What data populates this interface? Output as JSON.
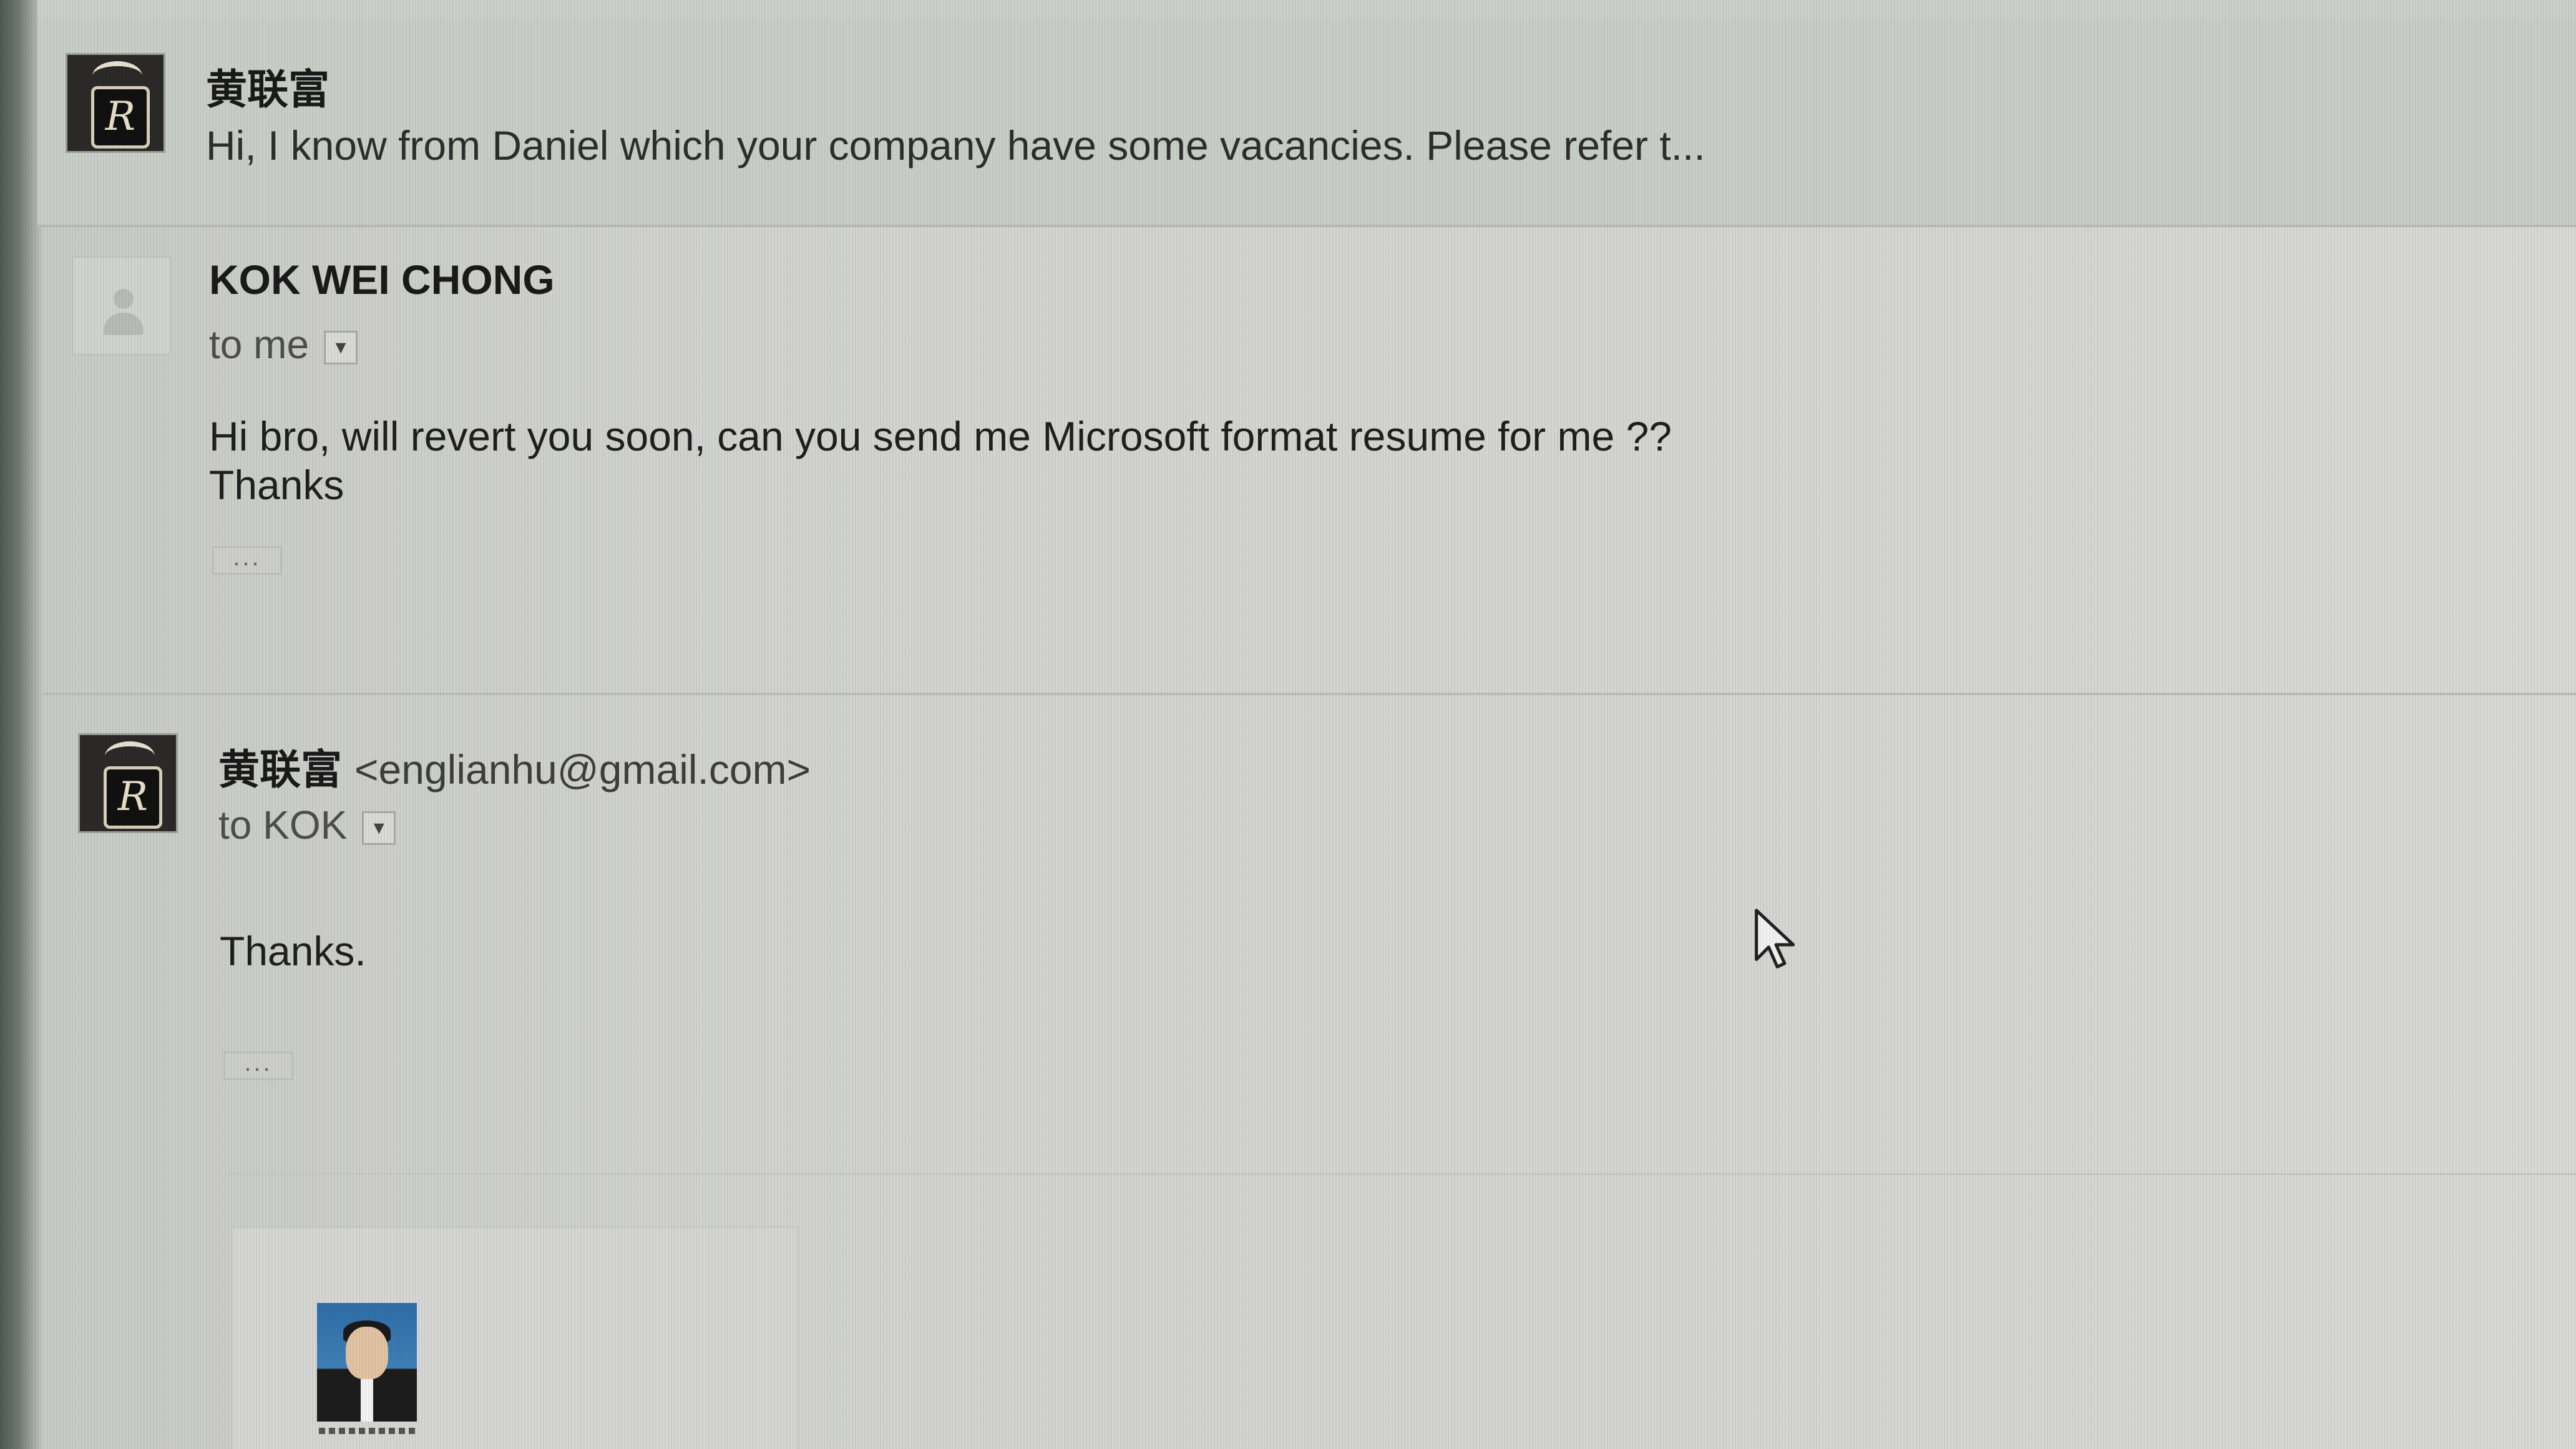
{
  "messages": [
    {
      "sender": "黄联富",
      "snippet": "Hi, I know from Daniel which your company have some vacancies. Please refer t...",
      "avatar_icon": "pendant-avatar-icon"
    },
    {
      "sender": "KOK WEI CHONG",
      "recipients": "to me",
      "body_lines": [
        "Hi bro, will revert you soon, can you send me Microsoft format resume for me ??",
        "Thanks"
      ],
      "ellipsis": "...",
      "avatar_icon": "default-person-avatar-icon"
    },
    {
      "sender": "黄联富",
      "email": "<englianhu@gmail.com>",
      "recipients": "to KOK",
      "body": "Thanks.",
      "ellipsis": "...",
      "avatar_icon": "pendant-avatar-icon",
      "attachment": {
        "thumbnail_icon": "resume-photo-thumbnail"
      }
    }
  ],
  "icons": {
    "dropdown": "chevron-down-icon",
    "cursor": "mouse-pointer-icon"
  },
  "colors": {
    "background": "#d3d4d1",
    "collapsed_header": "#c9cec9",
    "text": "#1f1f1f"
  }
}
